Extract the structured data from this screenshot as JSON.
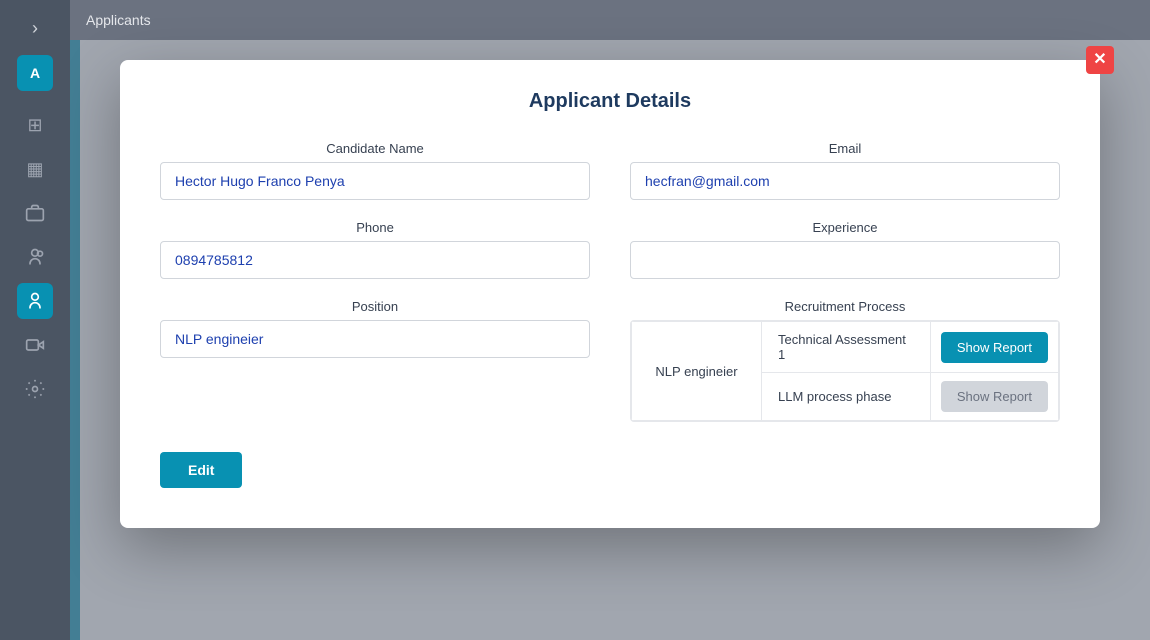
{
  "sidebar": {
    "logo_text": "A",
    "chevron": "›",
    "items": [
      {
        "name": "grid-icon",
        "symbol": "⊞",
        "active": false
      },
      {
        "name": "columns-icon",
        "symbol": "▦",
        "active": false
      },
      {
        "name": "briefcase-icon",
        "symbol": "💼",
        "active": false
      },
      {
        "name": "person-outline-icon",
        "symbol": "👤",
        "active": false
      },
      {
        "name": "person-icon",
        "symbol": "👤",
        "active": true
      },
      {
        "name": "video-icon",
        "symbol": "🎥",
        "active": false
      },
      {
        "name": "gear-icon",
        "symbol": "⚙",
        "active": false
      }
    ]
  },
  "topbar": {
    "title": "Applicants"
  },
  "modal": {
    "close_label": "✕",
    "title": "Applicant Details",
    "fields": {
      "candidate_name_label": "Candidate Name",
      "candidate_name_value": "Hector Hugo Franco Penya",
      "email_label": "Email",
      "email_value": "hecfran@gmail.com",
      "phone_label": "Phone",
      "phone_value": "0894785812",
      "experience_label": "Experience",
      "experience_value": "",
      "position_label": "Position",
      "position_value": "NLP engineier",
      "recruitment_label": "Recruitment Process"
    },
    "recruitment": {
      "position": "NLP engineier",
      "phases": [
        {
          "name": "Technical Assessment 1",
          "btn_label": "Show Report",
          "btn_active": true
        },
        {
          "name": "LLM process phase",
          "btn_label": "Show Report",
          "btn_active": false
        }
      ]
    },
    "edit_label": "Edit"
  }
}
